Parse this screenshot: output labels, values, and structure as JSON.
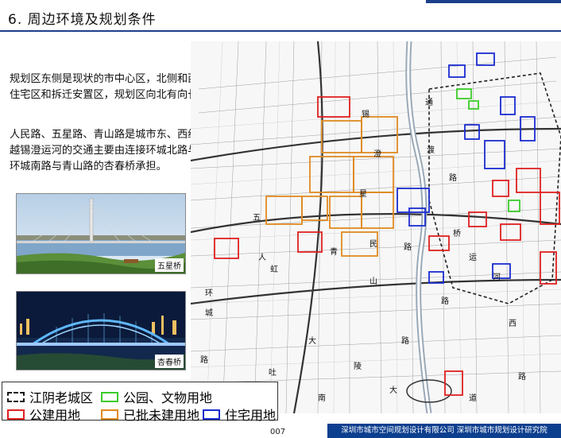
{
  "page": {
    "title": "6. 周边环境及规划条件",
    "page_number": "007",
    "footer_text": "深圳市城市空间规划设计有限公司 深圳市城市规划设计研究院"
  },
  "text": {
    "paragraph1": "规划区东侧是现状的市中心区，北侧和西侧是新建或在建的小型住宅区和拆迁安置区，规划区向北有向长江延伸之势。",
    "paragraph2": "人民路、五星路、青山路是城市东、西组团联系的重要道路。跨越锡澄运河的交通主要由连接环城北路与五星路的五星桥和连接环城南路与青山路的杏春桥承担。"
  },
  "photos": [
    {
      "caption": "五星桥"
    },
    {
      "caption": "杏春桥"
    }
  ],
  "map": {
    "labels": [
      "人",
      "民",
      "路",
      "五",
      "星",
      "路",
      "青",
      "山",
      "路",
      "通",
      "渡",
      "路",
      "南",
      "大",
      "道",
      "陵",
      "路",
      "环",
      "城",
      "西",
      "路",
      "吐",
      "大",
      "虹",
      "桥",
      "锡",
      "澄",
      "运",
      "河"
    ]
  },
  "legend": {
    "items": [
      {
        "label": "江阴老城区",
        "color": "#1a1a1a",
        "style": "dashed"
      },
      {
        "label": "公园、文物用地",
        "color": "#3ccc2a",
        "style": "solid"
      },
      {
        "label": "公建用地",
        "color": "#e02020",
        "style": "solid"
      },
      {
        "label": "已批未建用地",
        "color": "#e08a20",
        "style": "solid"
      },
      {
        "label": "住宅用地",
        "color": "#1a2bd0",
        "style": "solid"
      }
    ]
  }
}
